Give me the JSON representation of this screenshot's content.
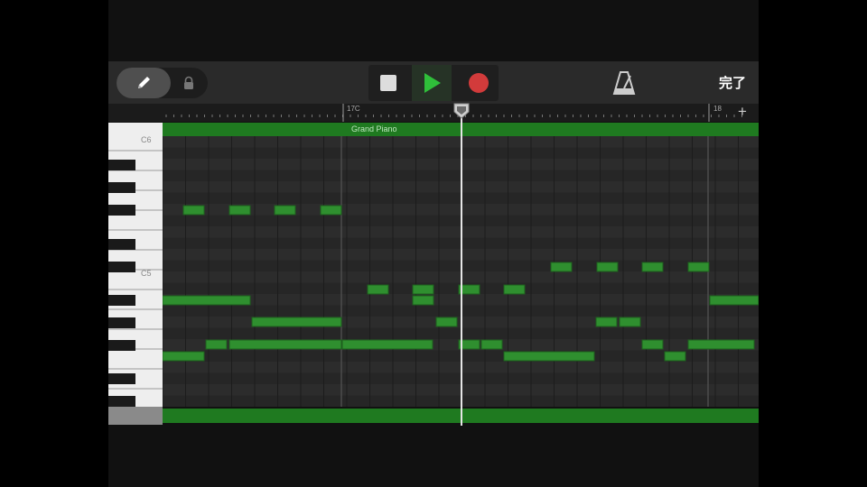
{
  "toolbar": {
    "done_label": "完了",
    "icons": [
      "pencil-icon",
      "lock-icon",
      "stop-icon",
      "play-icon",
      "record-icon",
      "metronome-icon"
    ],
    "colors": {
      "play": "#2fbf3a",
      "record": "#d23b3b"
    }
  },
  "ruler": {
    "bar_17": "17C",
    "bar_18": "18",
    "add_label": "+"
  },
  "region": {
    "name": "Grand Piano",
    "color": "#1f7a20"
  },
  "keyboard": {
    "c6_label": "C6",
    "c5_label": "C5"
  },
  "notes": {
    "color": "#2f8f2f"
  }
}
